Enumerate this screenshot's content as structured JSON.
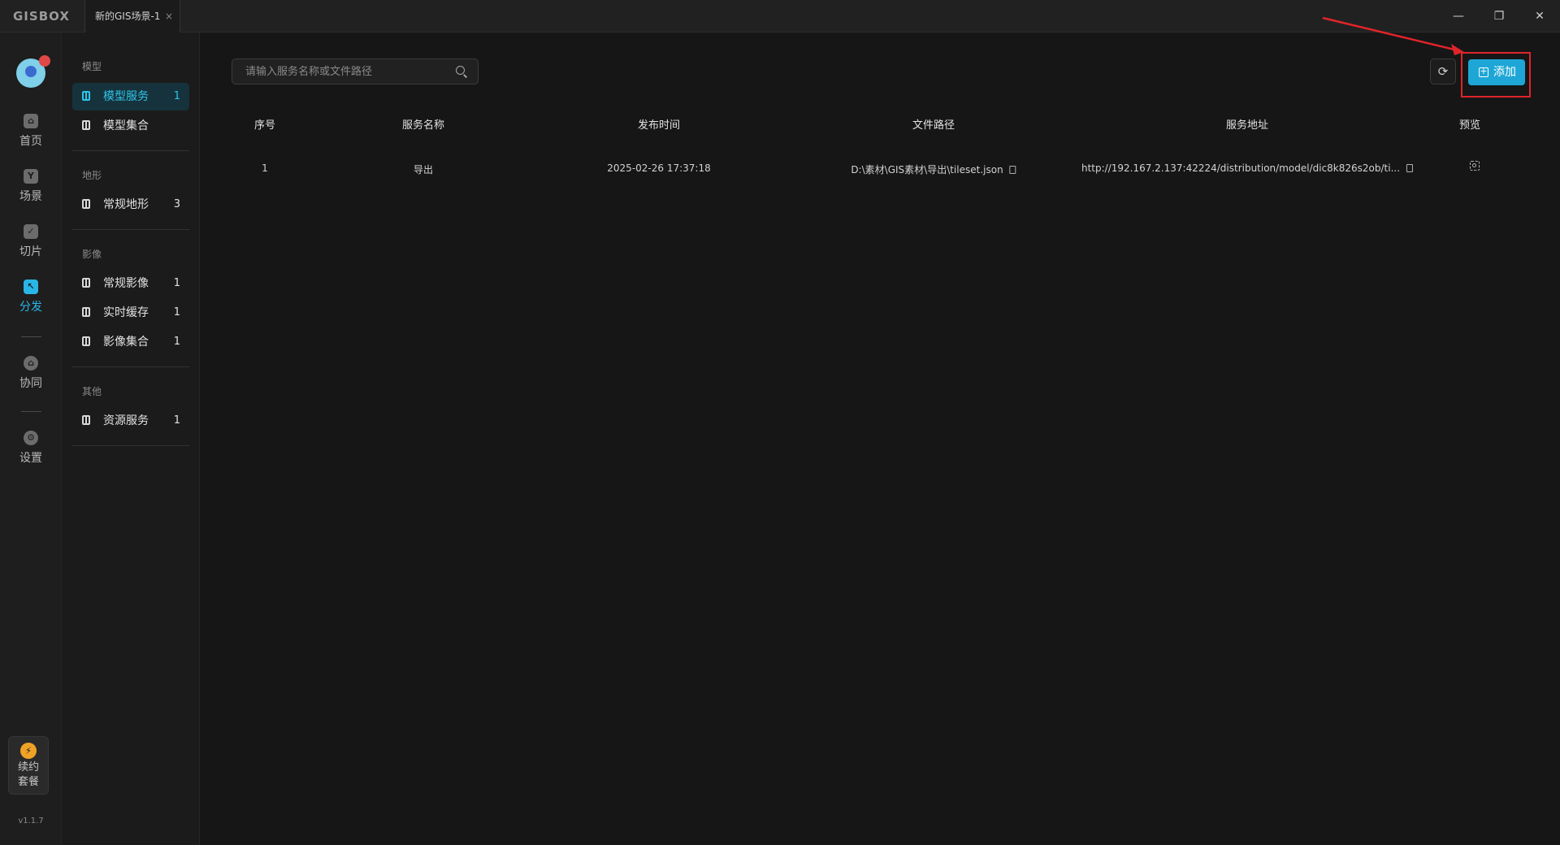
{
  "app": {
    "logo": "GISBOX"
  },
  "tabs": [
    {
      "label": "新的GIS场景-1",
      "close": "×"
    }
  ],
  "window_controls": {
    "minimize": "—",
    "restore": "❐",
    "close": "✕"
  },
  "rail": {
    "items": [
      {
        "label": "首页",
        "icon": "home-icon"
      },
      {
        "label": "场景",
        "icon": "scene-icon"
      },
      {
        "label": "切片",
        "icon": "slice-icon"
      },
      {
        "label": "分发",
        "icon": "distribute-icon",
        "active": true
      },
      {
        "label": "协同",
        "icon": "collaborate-icon"
      },
      {
        "label": "设置",
        "icon": "settings-icon"
      }
    ],
    "renew": {
      "line1": "续约",
      "line2": "套餐"
    },
    "version": "v1.1.7"
  },
  "categories": {
    "model": {
      "heading": "模型",
      "items": [
        {
          "label": "模型服务",
          "count": "1",
          "active": true
        },
        {
          "label": "模型集合",
          "count": ""
        }
      ]
    },
    "terrain": {
      "heading": "地形",
      "items": [
        {
          "label": "常规地形",
          "count": "3"
        }
      ]
    },
    "imagery": {
      "heading": "影像",
      "items": [
        {
          "label": "常规影像",
          "count": "1"
        },
        {
          "label": "实时缓存",
          "count": "1"
        },
        {
          "label": "影像集合",
          "count": "1"
        }
      ]
    },
    "other": {
      "heading": "其他",
      "items": [
        {
          "label": "资源服务",
          "count": "1"
        }
      ]
    }
  },
  "toolbar": {
    "search_placeholder": "请输入服务名称或文件路径",
    "refresh_icon": "refresh-icon",
    "add_label": "添加",
    "accent": "#1ea7d6",
    "annotation_color": "#e0242a"
  },
  "table": {
    "headers": [
      "序号",
      "服务名称",
      "发布时间",
      "文件路径",
      "服务地址",
      "预览"
    ],
    "rows": [
      {
        "index": "1",
        "name": "导出",
        "published": "2025-02-26 17:37:18",
        "path": "D:\\素材\\GIS素材\\导出\\tileset.json",
        "url": "http://192.167.2.137:42224/distribution/model/dic8k826s2ob/ti..."
      }
    ]
  }
}
